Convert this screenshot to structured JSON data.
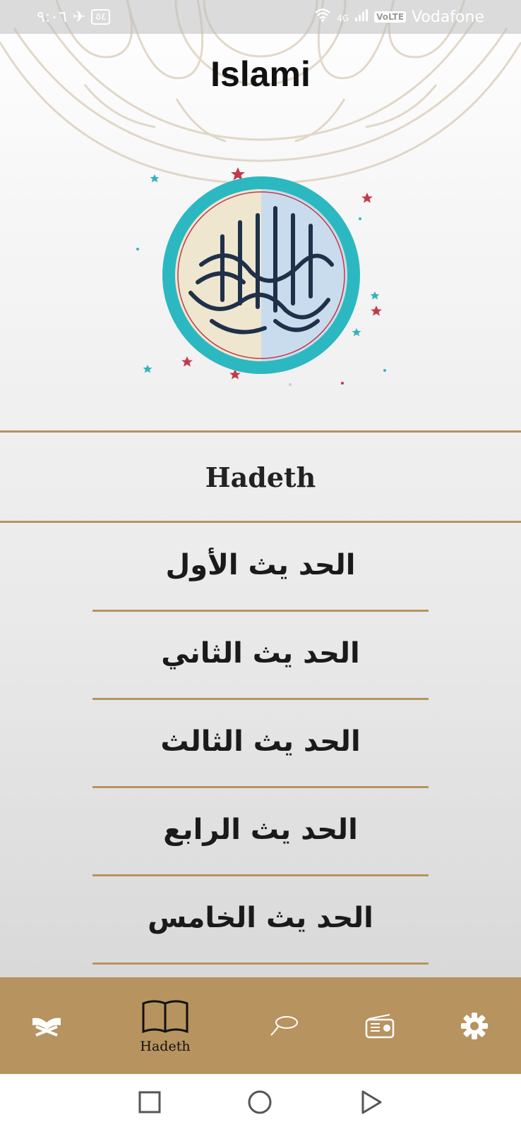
{
  "status_bar": {
    "time": "٩:٠٦",
    "battery": "٥٤",
    "network": "4G",
    "volte": "VoLTE",
    "carrier": "Vodafone"
  },
  "app": {
    "title": "Islami"
  },
  "section": {
    "title": "Hadeth"
  },
  "hadeth_list": [
    {
      "label": "الحد يث الأول"
    },
    {
      "label": "الحد يث الثاني"
    },
    {
      "label": "الحد يث الثالث"
    },
    {
      "label": "الحد يث الرابع"
    },
    {
      "label": "الحد يث الخامس"
    }
  ],
  "bottom_nav": {
    "items": [
      {
        "icon": "quran-stand-icon",
        "label": ""
      },
      {
        "icon": "open-book-icon",
        "label": "Hadeth",
        "active": true
      },
      {
        "icon": "tasbeeh-icon",
        "label": ""
      },
      {
        "icon": "radio-icon",
        "label": ""
      },
      {
        "icon": "gear-icon",
        "label": ""
      }
    ]
  },
  "colors": {
    "accent_gold": "#b7935f",
    "text_dark": "#1a1a1a",
    "emblem_teal": "#2cb8c0"
  }
}
